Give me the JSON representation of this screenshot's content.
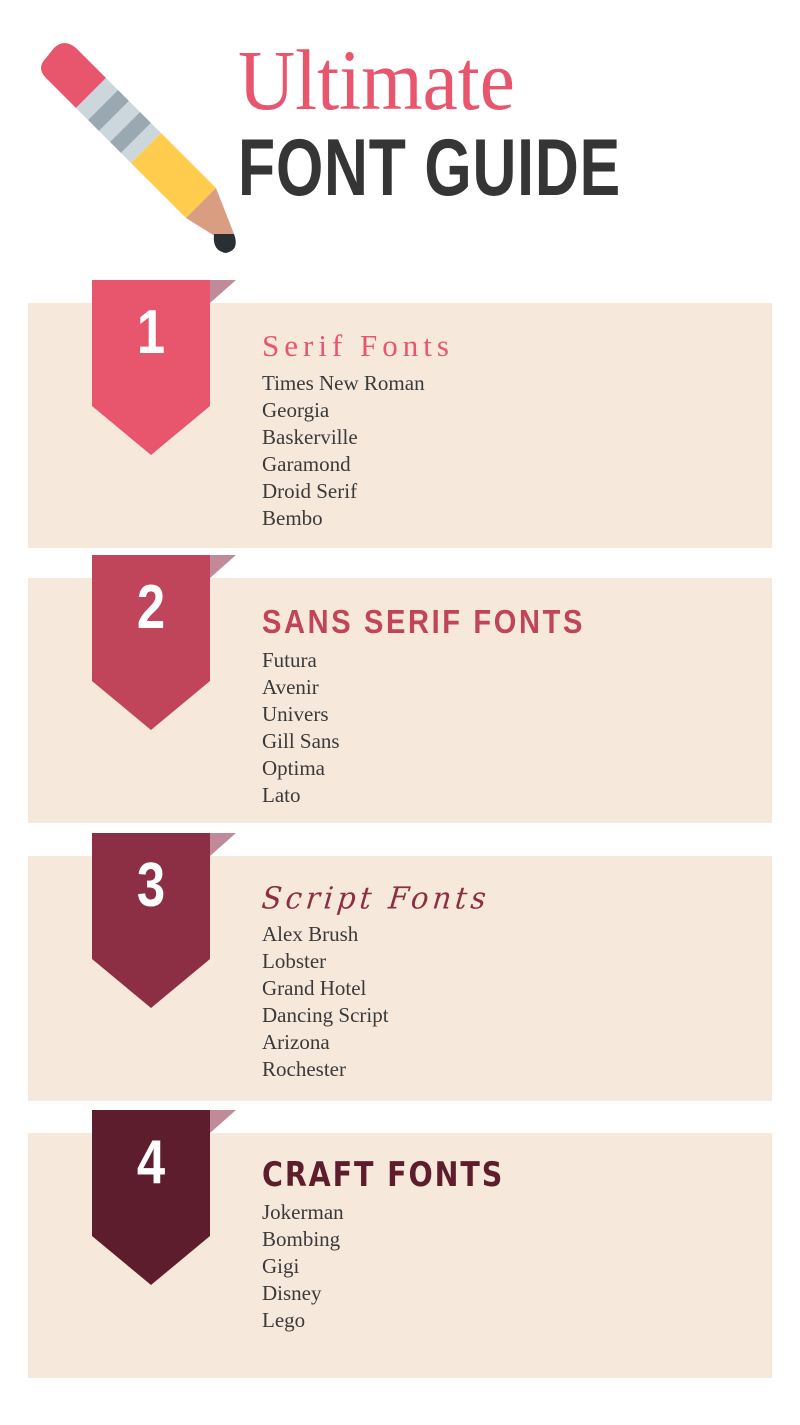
{
  "header": {
    "title_line1": "Ultimate",
    "title_line2": "FONT GUIDE",
    "title_line1_color": "#e8566e",
    "title_line2_color": "#353535",
    "icon": "pencil-icon",
    "pencil_colors": {
      "eraser": "#e8566e",
      "ferrule_light": "#ccd6dd",
      "ferrule_dark": "#9aa8b2",
      "body": "#ffcc4d",
      "wood": "#d99e82",
      "tip": "#292f33"
    }
  },
  "background": "#ffffff",
  "panel_color": "#f7e8dc",
  "shadow_color": "#c08a99",
  "list_text_color": "#3a3a3a",
  "sections": [
    {
      "number": "1",
      "heading": "Serif Fonts",
      "heading_style": "serif",
      "banner_color": "#e8566e",
      "heading_color": "#e8566e",
      "fonts": [
        "Times New Roman",
        "Georgia",
        "Baskerville",
        "Garamond",
        "Droid Serif",
        "Bembo"
      ]
    },
    {
      "number": "2",
      "heading": "SANS SERIF FONTS",
      "heading_style": "sans",
      "banner_color": "#c0445a",
      "heading_color": "#c0445a",
      "fonts": [
        "Futura",
        "Avenir",
        "Univers",
        "Gill Sans",
        "Optima",
        "Lato"
      ]
    },
    {
      "number": "3",
      "heading": "Script Fonts",
      "heading_style": "script",
      "banner_color": "#8d2f44",
      "heading_color": "#8d2f44",
      "fonts": [
        "Alex Brush",
        "Lobster",
        "Grand Hotel",
        "Dancing Script",
        "Arizona",
        "Rochester"
      ]
    },
    {
      "number": "4",
      "heading": "CRAFT FONTS",
      "heading_style": "craft",
      "banner_color": "#5e1d2c",
      "heading_color": "#5e1d2c",
      "fonts": [
        "Jokerman",
        "Bombing",
        "Gigi",
        "Disney",
        "Lego"
      ]
    }
  ]
}
